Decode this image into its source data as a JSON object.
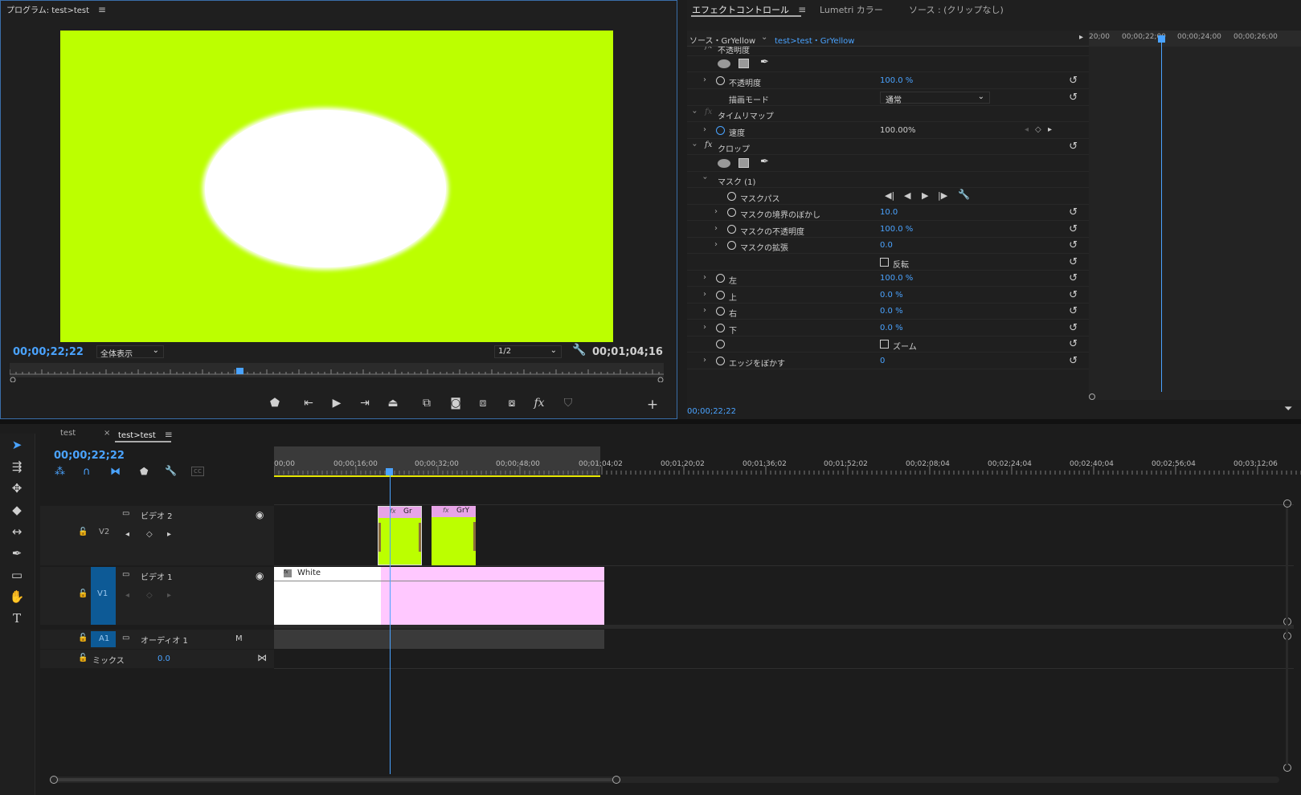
{
  "program": {
    "tab": "プログラム: test>test",
    "tc_current": "00;00;22;22",
    "zoom": "全体表示",
    "resolution": "1/2",
    "tc_duration": "00;01;04;16"
  },
  "effects": {
    "tabs": [
      "エフェクトコントロール",
      "Lumetri カラー",
      "ソース : (クリップなし)"
    ],
    "source": "ソース・GrYellow",
    "sequence": "test>test・GrYellow",
    "ruler_labels": [
      "20;00",
      "00;00;22;00",
      "00;00;24;00",
      "00;00;26;00"
    ],
    "rows": {
      "opacity_header": "不透明度",
      "opacity": {
        "label": "不透明度",
        "value": "100.0 %"
      },
      "blend": {
        "label": "描画モード",
        "value": "通常"
      },
      "timeremap": "タイムリマップ",
      "speed": {
        "label": "速度",
        "value": "100.00%"
      },
      "crop": "クロップ",
      "mask": "マスク (1)",
      "maskpath": "マスクパス",
      "feather": {
        "label": "マスクの境界のぼかし",
        "value": "10.0"
      },
      "maskopacity": {
        "label": "マスクの不透明度",
        "value": "100.0 %"
      },
      "expansion": {
        "label": "マスクの拡張",
        "value": "0.0"
      },
      "inverted": "反転",
      "left": {
        "label": "左",
        "value": "100.0 %"
      },
      "top": {
        "label": "上",
        "value": "0.0 %"
      },
      "right": {
        "label": "右",
        "value": "0.0 %"
      },
      "bottom": {
        "label": "下",
        "value": "0.0 %"
      },
      "zoom": "ズーム",
      "edgefeather": {
        "label": "エッジをぼかす",
        "value": "0"
      }
    },
    "tc": "00;00;22;22"
  },
  "timeline": {
    "tabs": [
      "test",
      "test>test"
    ],
    "tc": "00;00;22;22",
    "ruler": [
      "00;00",
      "00;00;16;00",
      "00;00;32;00",
      "00;00;48;00",
      "00;01;04;02",
      "00;01;20;02",
      "00;01;36;02",
      "00;01;52;02",
      "00;02;08;04",
      "00;02;24;04",
      "00;02;40;04",
      "00;02;56;04",
      "00;03;12;06"
    ],
    "tracks": {
      "v2": {
        "id": "V2",
        "name": "ビデオ 2"
      },
      "v1": {
        "id": "V1",
        "name": "ビデオ 1"
      },
      "a1": {
        "id": "A1",
        "name": "オーディオ 1",
        "m": "M"
      },
      "mix": {
        "name": "ミックス",
        "value": "0.0"
      }
    },
    "clips": {
      "gr": "Gr",
      "gry": "GrY",
      "white": "White"
    }
  },
  "colors": {
    "accent": "#4aa3ff",
    "frame_bg": "#bcff00",
    "clip_pink": "#ffc8ff",
    "clip_green": "#bcff00"
  }
}
